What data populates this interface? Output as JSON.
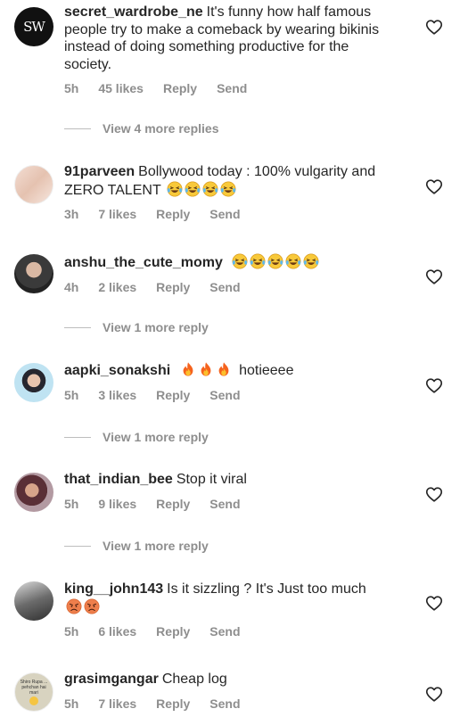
{
  "comments": [
    {
      "username": "secret_wardrobe_ne",
      "text": "It's funny how half famous people try to make a comeback by wearing bikinis instead of doing something productive for the society.",
      "emojis": [],
      "time": "5h",
      "likes": "45 likes",
      "reply": "Reply",
      "send": "Send",
      "avatar_text": "SW",
      "view_replies": "View 4 more replies"
    },
    {
      "username": "91parveen",
      "text": "Bollywood today : 100% vulgarity and ZERO TALENT",
      "emojis": [
        "laughing-tears",
        "laughing-tears",
        "laughing-tears",
        "laughing-tears"
      ],
      "time": "3h",
      "likes": "7 likes",
      "reply": "Reply",
      "send": "Send"
    },
    {
      "username": "anshu_the_cute_momy",
      "text": "",
      "emojis": [
        "laughing-tears",
        "laughing-tears",
        "laughing-tears",
        "laughing-tears",
        "laughing-tears"
      ],
      "time": "4h",
      "likes": "2 likes",
      "reply": "Reply",
      "send": "Send",
      "view_replies": "View 1 more reply"
    },
    {
      "username": "aapki_sonakshi",
      "text": "hotieeee",
      "emojis": [
        "fire",
        "fire",
        "fire"
      ],
      "time": "5h",
      "likes": "3 likes",
      "reply": "Reply",
      "send": "Send",
      "view_replies": "View 1 more reply"
    },
    {
      "username": "that_indian_bee",
      "text": "Stop it viral",
      "emojis": [],
      "time": "5h",
      "likes": "9 likes",
      "reply": "Reply",
      "send": "Send",
      "view_replies": "View 1 more reply"
    },
    {
      "username": "king__john143",
      "text": "Is it sizzling ? It's Just too much",
      "emojis": [
        "angry-face",
        "angry-face"
      ],
      "time": "5h",
      "likes": "6 likes",
      "reply": "Reply",
      "send": "Send"
    },
    {
      "username": "grasimgangar",
      "text": "Cheap log",
      "emojis": [],
      "time": "5h",
      "likes": "7 likes",
      "reply": "Reply",
      "send": "Send",
      "avatar_text": "Shiro Rupa ... pehchan hai mari"
    }
  ],
  "icons": {
    "heart": "heart-outline-icon",
    "laughing": "laughing-tears-emoji",
    "fire": "fire-emoji",
    "angry": "angry-face-emoji"
  },
  "colors": {
    "text": "#262626",
    "meta": "#8e8e8e",
    "divider": "#bdbdbd"
  }
}
